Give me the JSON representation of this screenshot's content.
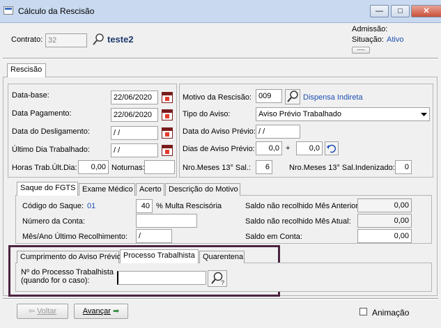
{
  "window": {
    "title": "Cálculo da Rescisão",
    "minimize": "—",
    "maximize": "□",
    "close": "✕"
  },
  "header": {
    "contract_label": "Contrato:",
    "contract_value": "32",
    "contract_name": "teste2",
    "admissao_label": "Admissão:",
    "situacao_label": "Situação:",
    "situacao_value": "Ativo",
    "more_button": "...."
  },
  "main_tab": "Rescisão",
  "left": {
    "data_base_label": "Data-base:",
    "data_base": "22/06/2020",
    "data_pagamento_label": "Data Pagamento:",
    "data_pagamento": "22/06/2020",
    "data_desligamento_label": "Data do Desligamento:",
    "data_desligamento": " / /",
    "ultimo_dia_label": "Último Dia Trabalhado:",
    "ultimo_dia": " / /",
    "horas_label": "Horas Trab.Últ.Dia:",
    "horas": "0,00",
    "noturnas_label": "Noturnas:",
    "noturnas": ""
  },
  "right": {
    "motivo_label": "Motivo da Rescisão:",
    "motivo_code": "009",
    "motivo_desc": "Dispensa Indireta",
    "tipo_aviso_label": "Tipo do Aviso:",
    "tipo_aviso": "Aviso Prévio Trabalhado",
    "data_aviso_label": "Data do Aviso Prévio:",
    "data_aviso": " / /",
    "dias_aviso_label": "Dias de Aviso Prévio:",
    "dias_aviso_1": "0,0",
    "plus": "+",
    "dias_aviso_2": "0,0",
    "nro13_label": "Nro.Meses 13° Sal.:",
    "nro13": "6",
    "nro13_ind_label": "Nro.Meses 13° Sal.Indenizado:",
    "nro13_ind": "0"
  },
  "fgts_tabs": [
    "Saque do FGTS",
    "Exame Médico",
    "Acerto",
    "Descrição do Motivo"
  ],
  "fgts": {
    "codigo_label": "Código do Saque:",
    "codigo": "01",
    "multa": "40",
    "multa_label": "% Multa Rescisória",
    "numero_conta_label": "Número da Conta:",
    "numero_conta": "",
    "mes_ano_label": "Mês/Ano Último Recolhimento:",
    "mes_ano": "/",
    "saldo_anterior_label": "Saldo não recolhido Mês Anterior:",
    "saldo_anterior": "0,00",
    "saldo_atual_label": "Saldo não recolhido Mês Atual:",
    "saldo_atual": "0,00",
    "saldo_conta_label": "Saldo em Conta:",
    "saldo_conta": "0,00"
  },
  "bottom_tabs": [
    "Cumprimento do Aviso Prévio",
    "Processo Trabalhista",
    "Quarentena"
  ],
  "processo": {
    "label_line1": "Nº do Processo Trabalhista",
    "label_line2": "(quando for o caso):",
    "value": ""
  },
  "footer": {
    "voltar": "Voltar",
    "avancar": "Avançar",
    "animacao": "Animação"
  },
  "colors": {
    "highlight_border": "#4a2340",
    "link": "#1c4fb0"
  }
}
